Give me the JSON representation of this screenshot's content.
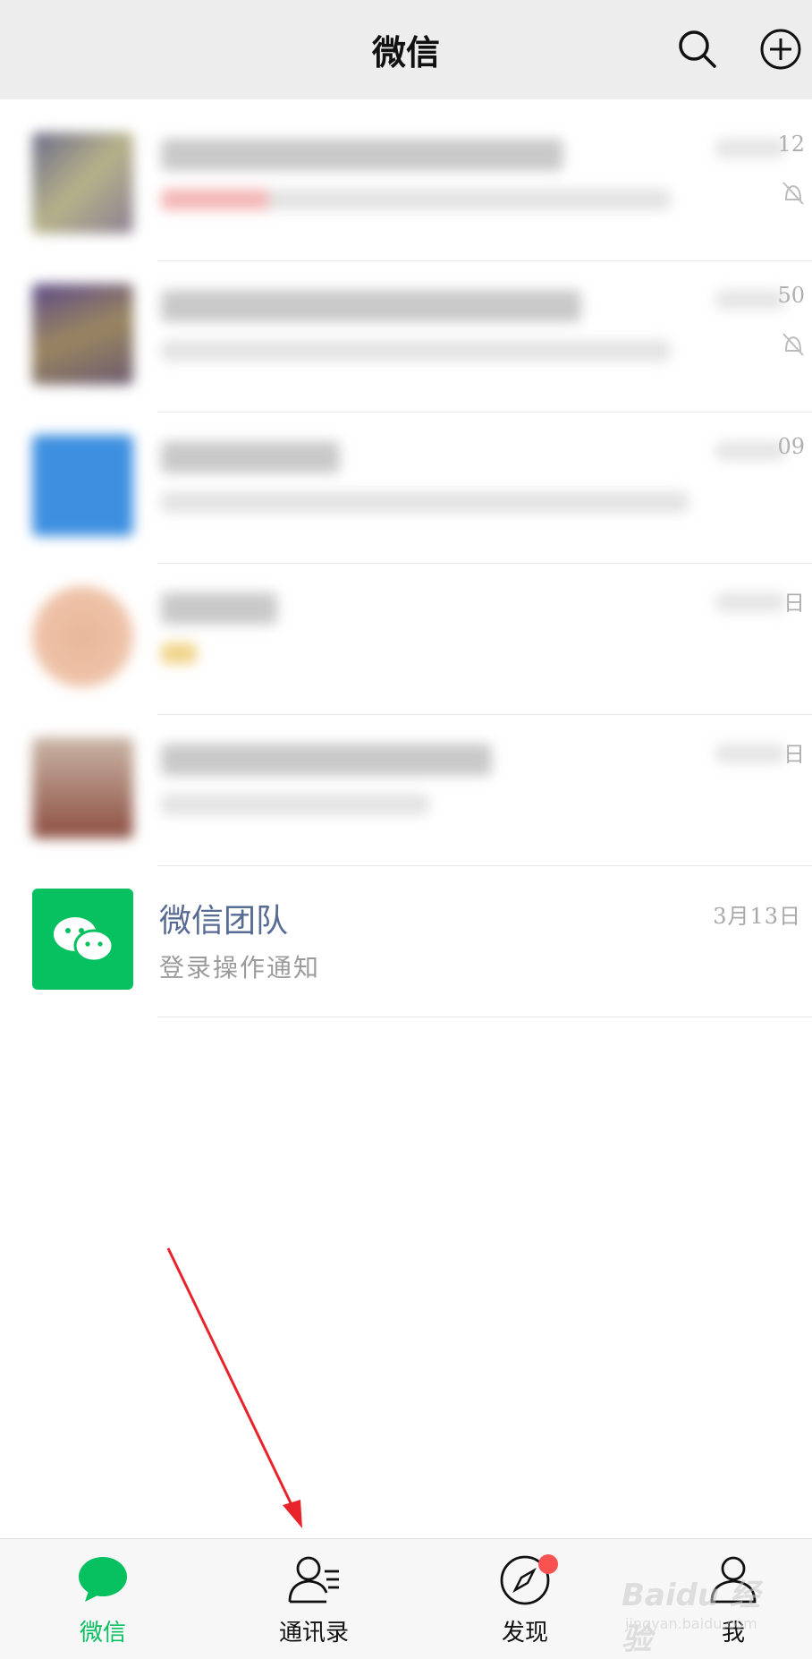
{
  "header": {
    "title": "微信",
    "search_icon": "search-icon",
    "add_icon": "plus-circle-icon"
  },
  "chats": [
    {
      "time_suffix": "12",
      "muted": true,
      "unread_dot": true
    },
    {
      "time_suffix": "50",
      "muted": true,
      "unread_dot": false
    },
    {
      "time_suffix": "09",
      "muted": false,
      "unread_dot": true
    },
    {
      "time_suffix": "日",
      "muted": false,
      "unread_dot": false
    },
    {
      "time_suffix": "日",
      "muted": false,
      "unread_dot": false
    }
  ],
  "official_chat": {
    "name": "微信团队",
    "preview": "登录操作通知",
    "time": "3月13日"
  },
  "tabbar": {
    "tabs": [
      {
        "label": "微信",
        "icon": "chat-bubble-icon",
        "active": true
      },
      {
        "label": "通讯录",
        "icon": "contacts-icon",
        "active": false
      },
      {
        "label": "发现",
        "icon": "compass-icon",
        "active": false,
        "badge": true
      },
      {
        "label": "我",
        "icon": "person-icon",
        "active": false
      }
    ]
  },
  "watermark": {
    "text": "Baidu 经验",
    "sub": "jingyan.baidu.com"
  },
  "colors": {
    "accent": "#07c160",
    "name_blue": "#576b95",
    "badge_red": "#fa5151",
    "annotation_arrow": "#e8232c"
  }
}
